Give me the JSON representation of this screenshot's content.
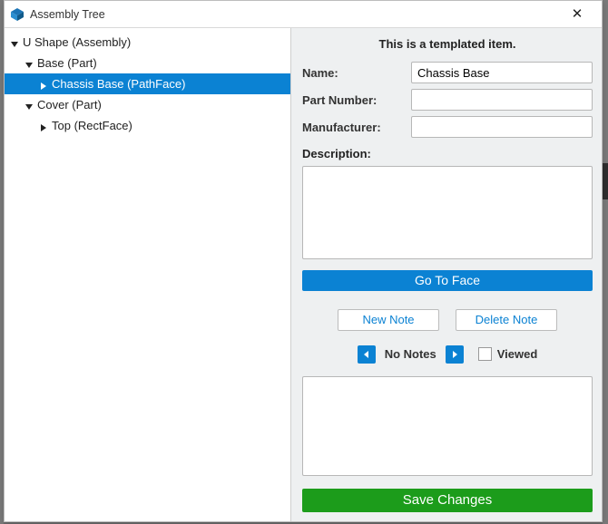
{
  "window": {
    "title": "Assembly Tree"
  },
  "tree": {
    "items": [
      {
        "label": "U Shape (Assembly)",
        "expanded": true,
        "level": 0,
        "selected": false
      },
      {
        "label": "Base (Part)",
        "expanded": true,
        "level": 1,
        "selected": false
      },
      {
        "label": "Chassis Base (PathFace)",
        "expanded": false,
        "level": 2,
        "selected": true
      },
      {
        "label": "Cover (Part)",
        "expanded": true,
        "level": 1,
        "selected": false
      },
      {
        "label": "Top (RectFace)",
        "expanded": false,
        "level": 2,
        "selected": false
      }
    ]
  },
  "details": {
    "templated_text": "This is a templated item.",
    "name_label": "Name:",
    "name_value": "Chassis Base",
    "partnum_label": "Part Number:",
    "partnum_value": "",
    "manufacturer_label": "Manufacturer:",
    "manufacturer_value": "",
    "description_label": "Description:",
    "description_value": "",
    "goto_label": "Go To Face"
  },
  "notes": {
    "new_label": "New Note",
    "delete_label": "Delete Note",
    "status": "No Notes",
    "viewed_label": "Viewed",
    "viewed_checked": false,
    "body": ""
  },
  "save": {
    "label": "Save Changes"
  }
}
